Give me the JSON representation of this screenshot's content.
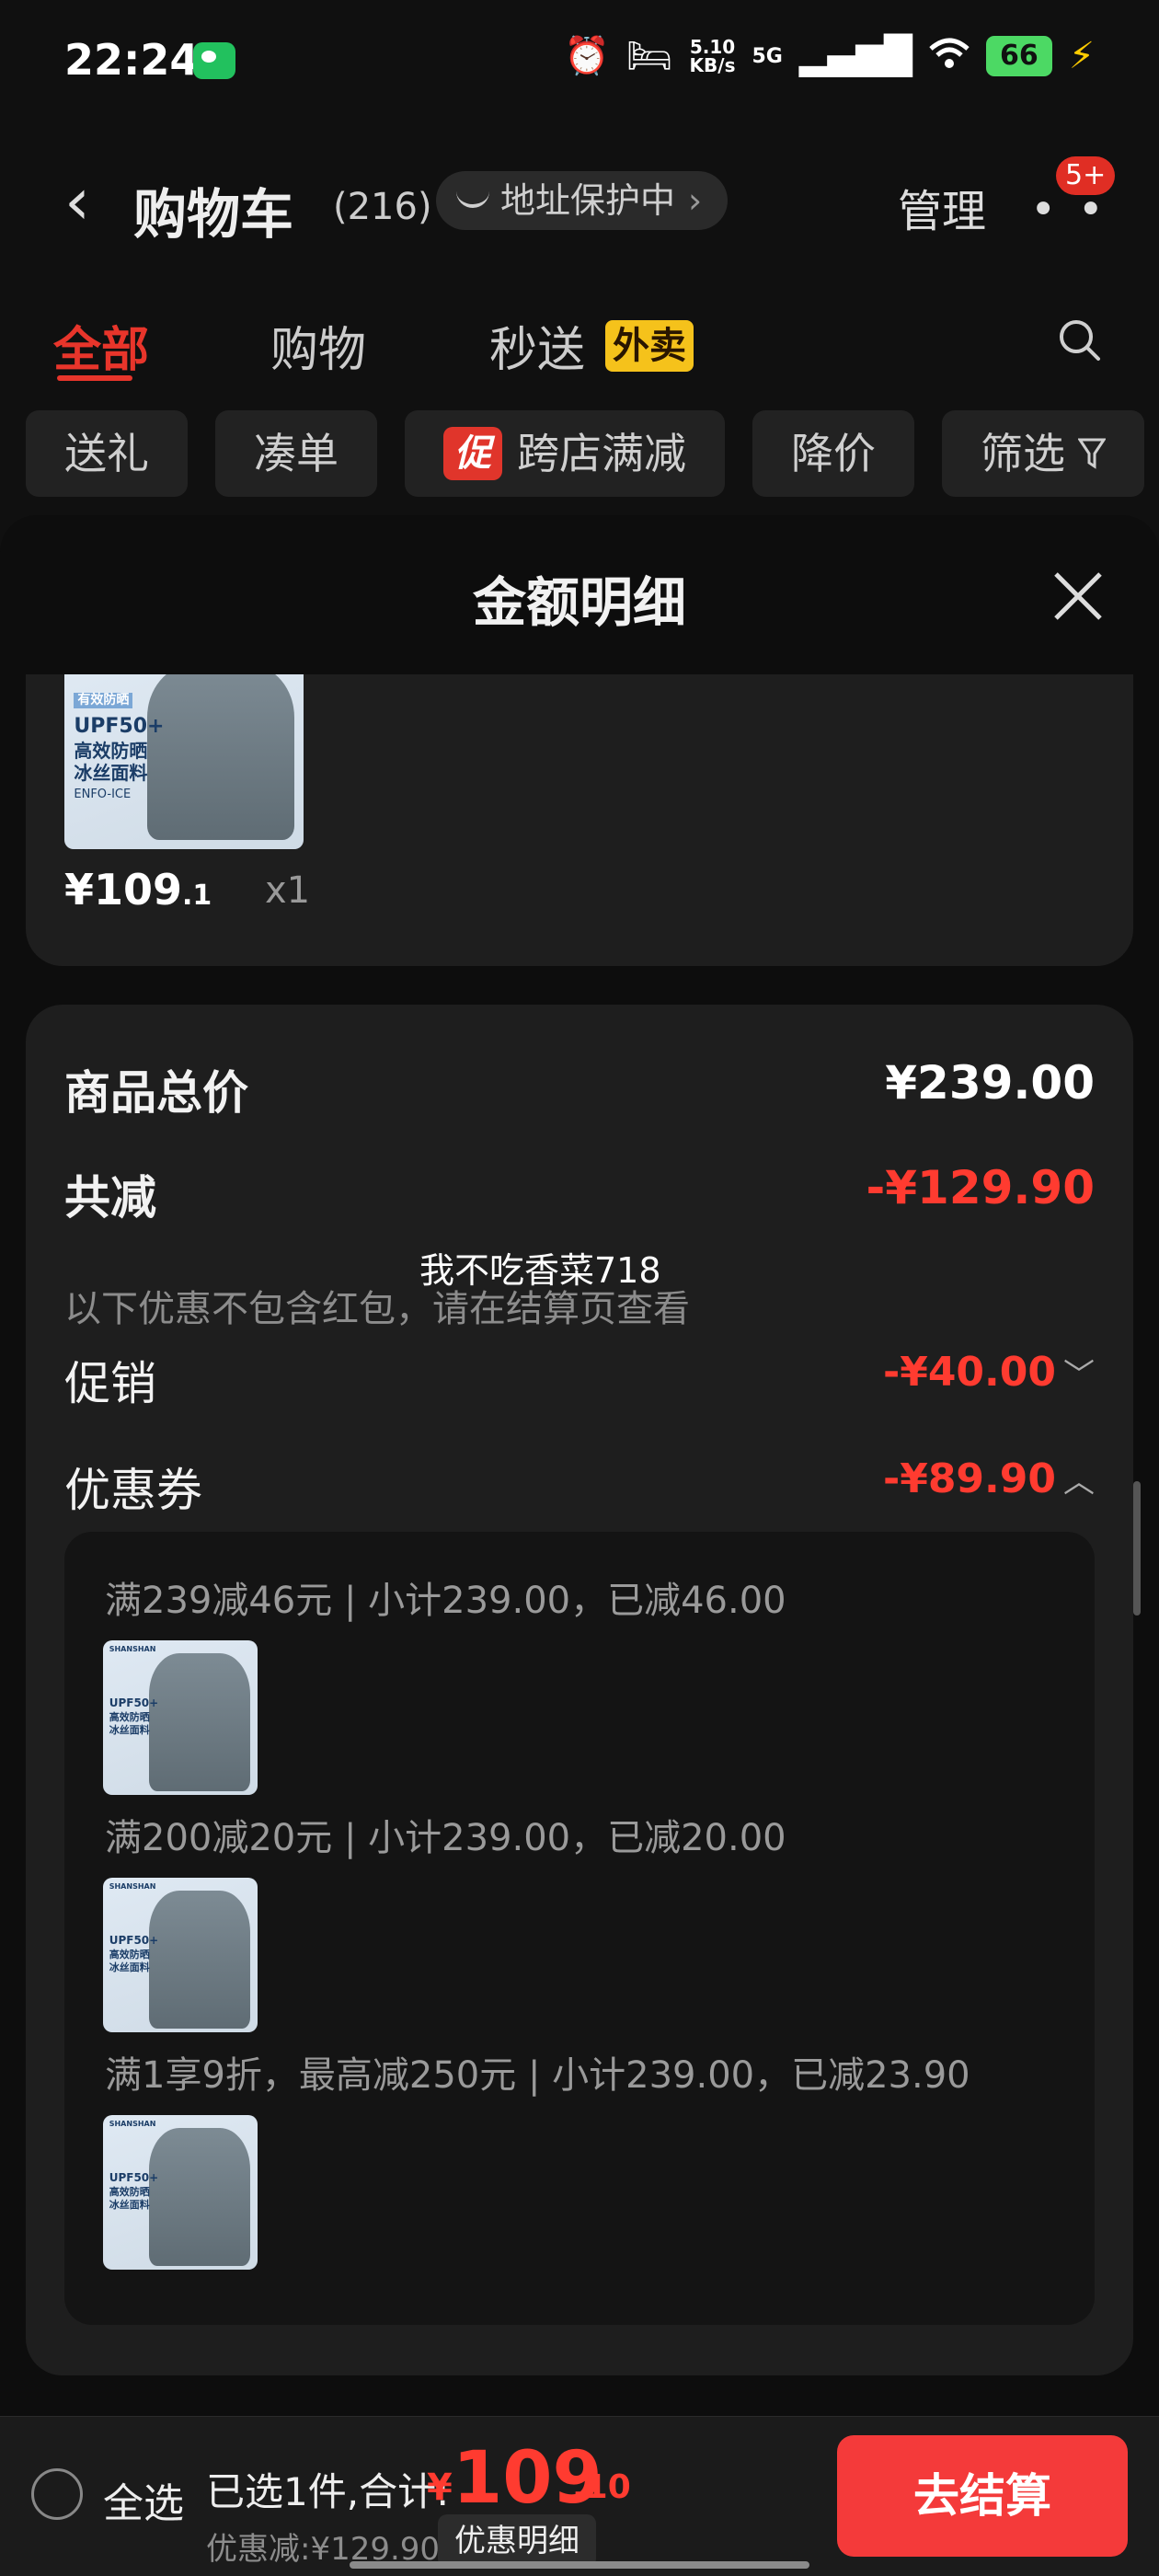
{
  "status_bar": {
    "time": "22:24",
    "net_speed_top": "5.10",
    "net_speed_bottom": "KB/s",
    "network": "5G",
    "battery": "66"
  },
  "header": {
    "back_icon": "chevron-left-icon",
    "title": "购物车",
    "count": "(216)",
    "address_protection": "地址保护中",
    "manage": "管理",
    "badge": "5+"
  },
  "tabs": [
    {
      "label": "全部",
      "active": true
    },
    {
      "label": "购物",
      "active": false
    },
    {
      "label": "秒送",
      "active": false
    }
  ],
  "waimai_badge": "外卖",
  "chips": [
    "送礼",
    "凑单",
    "跨店满减",
    "降价",
    "筛选"
  ],
  "promo_tag": "促",
  "sheet": {
    "title": "金额明细",
    "item_price_int": "¥109",
    "item_price_dec": ".1",
    "item_qty": "x1",
    "total_label": "商品总价",
    "total_value": "¥239.00",
    "reduce_label": "共减",
    "reduce_value": "-¥129.90",
    "reduce_note": "以下优惠不包含红包，请在结算页查看",
    "overlay_text": "我不吃香菜718",
    "promo_label": "促销",
    "promo_value": "-¥40.00",
    "coupon_label": "优惠券",
    "coupon_value": "-¥89.90",
    "coupon_lines": [
      "满239减46元 | 小计239.00，已减46.00",
      "满200减20元 | 小计239.00，已减20.00",
      "满1享9折，最高减250元 | 小计239.00，已减23.90"
    ],
    "product_image_text": {
      "badge": "有效防晒",
      "upf": "UPF50+",
      "line1": "高效防晒",
      "line2": "冰丝面料",
      "fabric": "ENFO-ICE",
      "brand": "SHANSHAN"
    }
  },
  "bottom": {
    "select_all": "全选",
    "selected_total_label": "已选1件,合计:",
    "total_yen": "¥",
    "total_int": "109",
    "total_dec": ".10",
    "discount": "优惠减:¥129.90",
    "detail_button": "优惠明细",
    "checkout": "去结算"
  },
  "colors": {
    "accent_red": "#ff3b30",
    "checkout_red": "#f43a3a",
    "waimai_yellow": "#f5c21b"
  }
}
